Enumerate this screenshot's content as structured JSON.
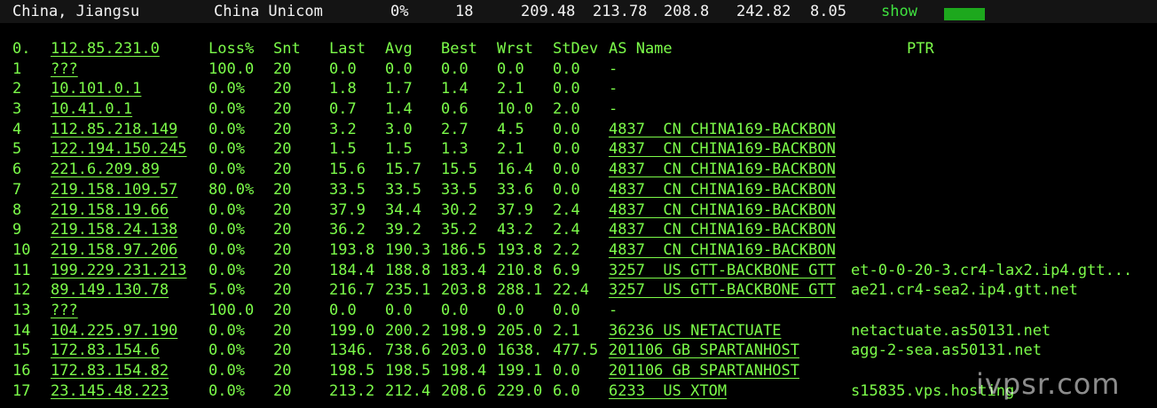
{
  "summary": {
    "location": "China, Jiangsu",
    "isp": "China Unicom",
    "loss": "0%",
    "snt": "18",
    "last": "209.48",
    "avg": "213.78",
    "best": "208.8",
    "wrst": "242.82",
    "stdev": "8.05",
    "show_label": "show",
    "accent_color": "#3fe13f"
  },
  "table": {
    "headers": {
      "idx": "0.",
      "host": "112.85.231.0",
      "loss": "Loss%",
      "snt": "Snt",
      "last": "Last",
      "avg": "Avg",
      "best": "Best",
      "wrst": "Wrst",
      "stdev": "StDev",
      "as": "AS Name",
      "ptr": "PTR"
    },
    "rows": [
      {
        "idx": "1",
        "host": "???",
        "loss": "100.0",
        "snt": "20",
        "last": "0.0",
        "avg": "0.0",
        "best": "0.0",
        "wrst": "0.0",
        "stdev": "0.0",
        "as": "-",
        "ptr": ""
      },
      {
        "idx": "2",
        "host": "10.101.0.1",
        "loss": "0.0%",
        "snt": "20",
        "last": "1.8",
        "avg": "1.7",
        "best": "1.4",
        "wrst": "2.1",
        "stdev": "0.0",
        "as": "-",
        "ptr": ""
      },
      {
        "idx": "3",
        "host": "10.41.0.1",
        "loss": "0.0%",
        "snt": "20",
        "last": "0.7",
        "avg": "1.4",
        "best": "0.6",
        "wrst": "10.0",
        "stdev": "2.0",
        "as": "-",
        "ptr": ""
      },
      {
        "idx": "4",
        "host": "112.85.218.149",
        "loss": "0.0%",
        "snt": "20",
        "last": "3.2",
        "avg": "3.0",
        "best": "2.7",
        "wrst": "4.5",
        "stdev": "0.0",
        "as": "4837  CN CHINA169-BACKBON",
        "ptr": ""
      },
      {
        "idx": "5",
        "host": "122.194.150.245",
        "loss": "0.0%",
        "snt": "20",
        "last": "1.5",
        "avg": "1.5",
        "best": "1.3",
        "wrst": "2.1",
        "stdev": "0.0",
        "as": "4837  CN CHINA169-BACKBON",
        "ptr": ""
      },
      {
        "idx": "6",
        "host": "221.6.209.89",
        "loss": "0.0%",
        "snt": "20",
        "last": "15.6",
        "avg": "15.7",
        "best": "15.5",
        "wrst": "16.4",
        "stdev": "0.0",
        "as": "4837  CN CHINA169-BACKBON",
        "ptr": ""
      },
      {
        "idx": "7",
        "host": "219.158.109.57",
        "loss": "80.0%",
        "snt": "20",
        "last": "33.5",
        "avg": "33.5",
        "best": "33.5",
        "wrst": "33.6",
        "stdev": "0.0",
        "as": "4837  CN CHINA169-BACKBON",
        "ptr": ""
      },
      {
        "idx": "8",
        "host": "219.158.19.66",
        "loss": "0.0%",
        "snt": "20",
        "last": "37.9",
        "avg": "34.4",
        "best": "30.2",
        "wrst": "37.9",
        "stdev": "2.4",
        "as": "4837  CN CHINA169-BACKBON",
        "ptr": ""
      },
      {
        "idx": "9",
        "host": "219.158.24.138",
        "loss": "0.0%",
        "snt": "20",
        "last": "36.2",
        "avg": "39.2",
        "best": "35.2",
        "wrst": "43.2",
        "stdev": "2.4",
        "as": "4837  CN CHINA169-BACKBON",
        "ptr": ""
      },
      {
        "idx": "10",
        "host": "219.158.97.206",
        "loss": "0.0%",
        "snt": "20",
        "last": "193.8",
        "avg": "190.3",
        "best": "186.5",
        "wrst": "193.8",
        "stdev": "2.2",
        "as": "4837  CN CHINA169-BACKBON",
        "ptr": ""
      },
      {
        "idx": "11",
        "host": "199.229.231.213",
        "loss": "0.0%",
        "snt": "20",
        "last": "184.4",
        "avg": "188.8",
        "best": "183.4",
        "wrst": "210.8",
        "stdev": "6.9",
        "as": "3257  US GTT-BACKBONE GTT",
        "ptr": "et-0-0-20-3.cr4-lax2.ip4.gtt..."
      },
      {
        "idx": "12",
        "host": "89.149.130.78",
        "loss": "5.0%",
        "snt": "20",
        "last": "216.7",
        "avg": "235.1",
        "best": "203.8",
        "wrst": "288.1",
        "stdev": "22.4",
        "as": "3257  US GTT-BACKBONE GTT",
        "ptr": "ae21.cr4-sea2.ip4.gtt.net"
      },
      {
        "idx": "13",
        "host": "???",
        "loss": "100.0",
        "snt": "20",
        "last": "0.0",
        "avg": "0.0",
        "best": "0.0",
        "wrst": "0.0",
        "stdev": "0.0",
        "as": "-",
        "ptr": ""
      },
      {
        "idx": "14",
        "host": "104.225.97.190",
        "loss": "0.0%",
        "snt": "20",
        "last": "199.0",
        "avg": "200.2",
        "best": "198.9",
        "wrst": "205.0",
        "stdev": "2.1",
        "as": "36236 US NETACTUATE",
        "ptr": "netactuate.as50131.net"
      },
      {
        "idx": "15",
        "host": "172.83.154.6",
        "loss": "0.0%",
        "snt": "20",
        "last": "1346.",
        "avg": "738.6",
        "best": "203.0",
        "wrst": "1638.",
        "stdev": "477.5",
        "as": "201106 GB SPARTANHOST",
        "ptr": "agg-2-sea.as50131.net"
      },
      {
        "idx": "16",
        "host": "172.83.154.82",
        "loss": "0.0%",
        "snt": "20",
        "last": "198.5",
        "avg": "198.5",
        "best": "198.4",
        "wrst": "199.1",
        "stdev": "0.0",
        "as": "201106 GB SPARTANHOST",
        "ptr": ""
      },
      {
        "idx": "17",
        "host": "23.145.48.223",
        "loss": "0.0%",
        "snt": "20",
        "last": "213.2",
        "avg": "212.4",
        "best": "208.6",
        "wrst": "229.0",
        "stdev": "6.0",
        "as": "6233  US XTOM",
        "ptr": "s15835.vps.hosting"
      }
    ]
  },
  "watermark": "ivpsr.com",
  "colors": {
    "text_green": "#7cfc4a",
    "background": "#000000",
    "topbar_bg": "#141414"
  }
}
